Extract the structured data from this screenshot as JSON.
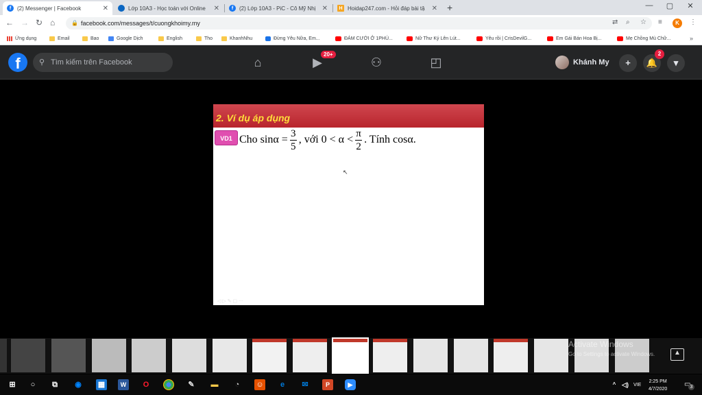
{
  "tabs": [
    {
      "title": "(2) Messenger | Facebook",
      "favicon": "facebook-icon",
      "color": "#1877f2",
      "active": true
    },
    {
      "title": "Lớp 10A3 - Học toán với Online",
      "favicon": "onedrive-icon",
      "color": "#0a66c2"
    },
    {
      "title": "(2) Lớp 10A3 - PiC - Cô Mỹ Nhị",
      "favicon": "facebook-icon",
      "color": "#1877f2"
    },
    {
      "title": "Hoidap247.com - Hỏi đáp bài tậ",
      "favicon": "hoidap-icon",
      "color": "#f5a623"
    }
  ],
  "url": "facebook.com/messages/t/cuongkhoimy.my",
  "profile_initial": "K",
  "bookmarks": [
    {
      "label": "Ứng dụng",
      "icon": "apps-icon"
    },
    {
      "label": "Email",
      "icon": "folder-icon"
    },
    {
      "label": "Bao",
      "icon": "folder-icon"
    },
    {
      "label": "Google Dịch",
      "icon": "translate-icon"
    },
    {
      "label": "English",
      "icon": "folder-icon"
    },
    {
      "label": "Tho",
      "icon": "folder-icon"
    },
    {
      "label": "KhanhNhu",
      "icon": "folder-icon"
    },
    {
      "label": "Đừng Yêu Nữa, Em...",
      "icon": "bookmark-icon"
    },
    {
      "label": "ĐÁM CƯỚI Ở 1PHÚ...",
      "icon": "youtube-icon"
    },
    {
      "label": "Nữ Thư Ký Lên Lút...",
      "icon": "youtube-icon"
    },
    {
      "label": "Yêu rồi | CrisDevilG...",
      "icon": "youtube-icon"
    },
    {
      "label": "Em Gái Bán Hoa Bị...",
      "icon": "youtube-icon"
    },
    {
      "label": "Mẹ Chồng Mù Chữ...",
      "icon": "youtube-icon"
    }
  ],
  "fb": {
    "search_placeholder": "Tìm kiếm trên Facebook",
    "watch_badge": "20+",
    "user_name": "Khánh My",
    "notif_badge": "2"
  },
  "slide": {
    "heading": "2. Ví dụ áp dụng",
    "tag": "VD1",
    "text_a": "Cho sinα =",
    "num1": "3",
    "den1": "5",
    "text_b": ", với 0 < α <",
    "num2": "π",
    "den2": "2",
    "text_c": ". Tính cosα."
  },
  "watermark": {
    "line1": "Activate Windows",
    "line2": "Go to Settings to activate Windows."
  },
  "taskbar": {
    "lang": "VIE",
    "time": "2:25 PM",
    "date": "4/7/2020",
    "notif_count": "3"
  }
}
